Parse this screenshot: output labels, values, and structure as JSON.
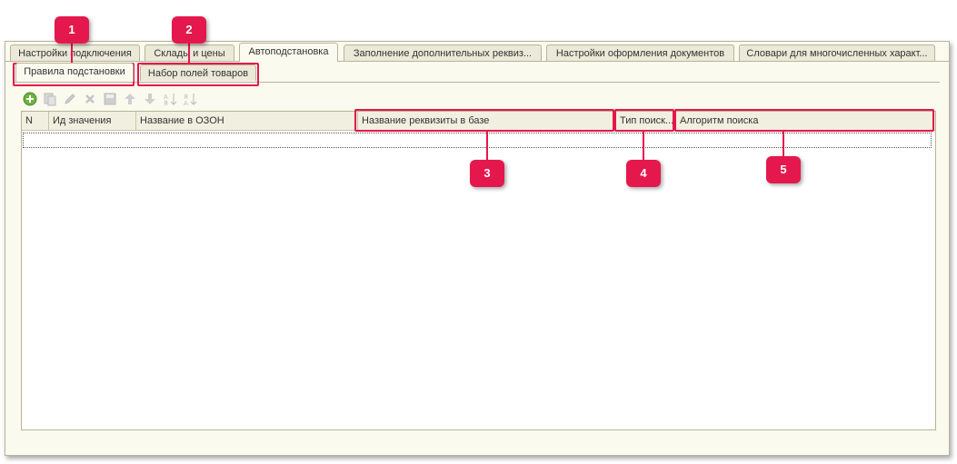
{
  "top_tabs": [
    {
      "label": "Настройки подключения",
      "active": false
    },
    {
      "label": "Склады и цены",
      "active": false
    },
    {
      "label": "Автоподстановка",
      "active": true
    },
    {
      "label": "Заполнение дополнительных реквиз...",
      "active": false
    },
    {
      "label": "Настройки оформления документов",
      "active": false
    },
    {
      "label": "Словари для многочисленных характ...",
      "active": false
    }
  ],
  "sub_tabs": [
    {
      "label": "Правила подстановки",
      "active": true
    },
    {
      "label": "Набор полей товаров",
      "active": false
    }
  ],
  "toolbar": {
    "icons": [
      "add-icon",
      "copy-icon",
      "edit-icon",
      "delete-icon",
      "save-icon",
      "move-up-icon",
      "move-down-icon",
      "sort-asc-icon",
      "sort-desc-icon"
    ]
  },
  "table": {
    "columns": [
      "N",
      "Ид значения",
      "Название в ОЗОН",
      "Название реквизиты в базе",
      "Тип поиск...",
      "Алгоритм поиска"
    ]
  },
  "callouts": [
    "1",
    "2",
    "3",
    "4",
    "5"
  ],
  "colors": {
    "accent": "#e4184c",
    "panel": "#fbfaef",
    "border": "#b9b39a"
  }
}
